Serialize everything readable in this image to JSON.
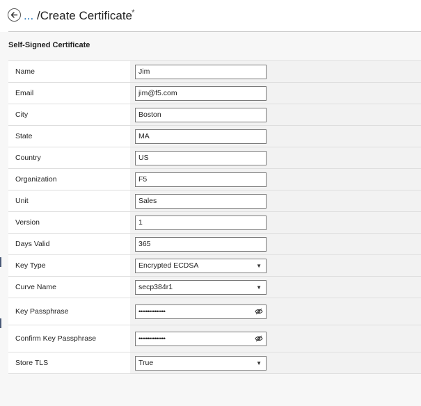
{
  "header": {
    "ellipsis": "...",
    "title": "/Create Certificate",
    "unsaved_marker": "*"
  },
  "section": {
    "title": "Self-Signed Certificate"
  },
  "fields": {
    "name": {
      "label": "Name",
      "value": "Jim"
    },
    "email": {
      "label": "Email",
      "value": "jim@f5.com"
    },
    "city": {
      "label": "City",
      "value": "Boston"
    },
    "state": {
      "label": "State",
      "value": "MA"
    },
    "country": {
      "label": "Country",
      "value": "US"
    },
    "organization": {
      "label": "Organization",
      "value": "F5"
    },
    "unit": {
      "label": "Unit",
      "value": "Sales"
    },
    "version": {
      "label": "Version",
      "value": "1"
    },
    "days_valid": {
      "label": "Days Valid",
      "value": "365"
    },
    "key_type": {
      "label": "Key Type",
      "value": "Encrypted ECDSA"
    },
    "curve_name": {
      "label": "Curve Name",
      "value": "secp384r1"
    },
    "key_passphrase": {
      "label": "Key Passphrase",
      "masked": "•••••••••••••••"
    },
    "confirm_key_passphrase": {
      "label": "Confirm Key Passphrase",
      "masked": "•••••••••••••••"
    },
    "store_tls": {
      "label": "Store TLS",
      "value": "True"
    }
  },
  "icons": {
    "back": "arrow-left-circle-icon",
    "dropdown": "caret-down-icon",
    "visibility": "eye-off-icon"
  },
  "colors": {
    "link": "#1a6fb5",
    "page_bg": "#f7f7f7",
    "row_border": "#dedede"
  }
}
